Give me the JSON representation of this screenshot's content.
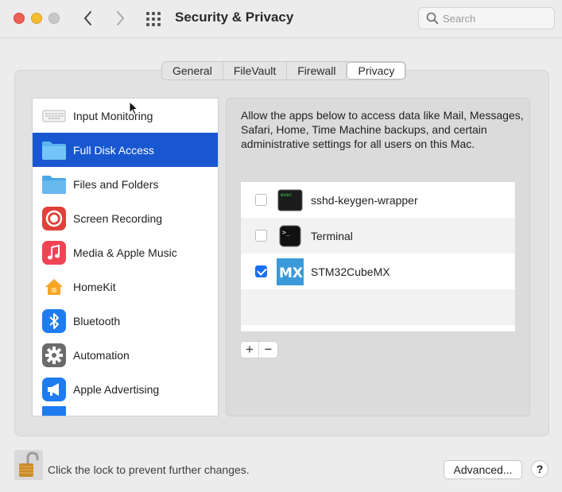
{
  "window": {
    "title": "Security & Privacy"
  },
  "search": {
    "placeholder": "Search"
  },
  "tabs": [
    {
      "label": "General",
      "active": false
    },
    {
      "label": "FileVault",
      "active": false
    },
    {
      "label": "Firewall",
      "active": false
    },
    {
      "label": "Privacy",
      "active": true
    }
  ],
  "sidebar": {
    "items": [
      {
        "label": "Input Monitoring",
        "icon": "keyboard-icon",
        "selected": false
      },
      {
        "label": "Full Disk Access",
        "icon": "folder-icon",
        "selected": true
      },
      {
        "label": "Files and Folders",
        "icon": "folder-icon",
        "selected": false
      },
      {
        "label": "Screen Recording",
        "icon": "record-icon",
        "selected": false
      },
      {
        "label": "Media & Apple Music",
        "icon": "music-note-icon",
        "selected": false
      },
      {
        "label": "HomeKit",
        "icon": "home-icon",
        "selected": false
      },
      {
        "label": "Bluetooth",
        "icon": "bluetooth-icon",
        "selected": false
      },
      {
        "label": "Automation",
        "icon": "gear-icon",
        "selected": false
      },
      {
        "label": "Apple Advertising",
        "icon": "megaphone-icon",
        "selected": false
      }
    ]
  },
  "content": {
    "description": "Allow the apps below to access data like Mail, Messages, Safari, Home, Time Machine backups, and certain administrative settings for all users on this Mac.",
    "apps": [
      {
        "name": "sshd-keygen-wrapper",
        "checked": false,
        "icon": "exec-terminal-icon",
        "icon_text": "exec"
      },
      {
        "name": "Terminal",
        "checked": false,
        "icon": "terminal-icon",
        "icon_text": ">_"
      },
      {
        "name": "STM32CubeMX",
        "checked": true,
        "icon": "stm32cubemx-icon",
        "icon_text": "MX"
      }
    ],
    "add_label": "+",
    "remove_label": "−"
  },
  "footer": {
    "lock_text": "Click the lock to prevent further changes.",
    "advanced_label": "Advanced...",
    "help_label": "?"
  },
  "colors": {
    "selection": "#1857d0",
    "checkbox_checked": "#1a6ef0",
    "close": "#ee5f57",
    "minimize": "#f5bd30"
  }
}
